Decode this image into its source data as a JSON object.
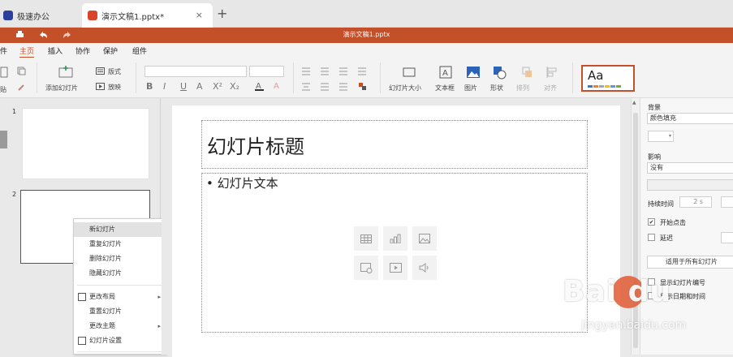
{
  "tabs": {
    "home": "极速办公",
    "doc": "演示文稿1.pptx*",
    "close": "×",
    "add": "+"
  },
  "window": {
    "title": "演示文稿1.pptx"
  },
  "colors": {
    "accent": "#c4502a",
    "tab_icon": "#d9442a",
    "home_icon": "#2b3f9c"
  },
  "menu": [
    "件",
    "主页",
    "插入",
    "协作",
    "保护",
    "组件"
  ],
  "ribbon": {
    "paste": "贴",
    "add_slide": "添加幻灯片",
    "layout": "版式",
    "play": "放映",
    "slide_size": "幻灯片大小",
    "textbox": "文本框",
    "image": "图片",
    "shape": "形状",
    "arrange": "排列",
    "align": "对齐",
    "style_sample": "Aa",
    "format_letters": [
      "B",
      "I",
      "U",
      "A",
      "X²",
      "X₂"
    ]
  },
  "thumbs": {
    "n1": "1",
    "n2": "2"
  },
  "context_menu": [
    "新幻灯片",
    "重复幻灯片",
    "删除幻灯片",
    "隐藏幻灯片",
    "更改布局",
    "重置幻灯片",
    "更改主题",
    "幻灯片设置"
  ],
  "slide": {
    "title": "幻灯片标题",
    "body": "• 幻灯片文本"
  },
  "panel": {
    "background": "背景",
    "fill": "颜色填充",
    "effect": "影响",
    "effect_value": "没有",
    "duration": "持续时间",
    "duration_value": "2 s",
    "on_click": "开始点击",
    "on_click_checked": true,
    "delay": "延迟",
    "apply_all": "适用于所有幻灯片",
    "show_number": "显示幻灯片编号",
    "show_datetime": "显示日期和时间"
  },
  "watermark": {
    "main": "Bai  du",
    "sub": "jingyan.baidu.com"
  }
}
